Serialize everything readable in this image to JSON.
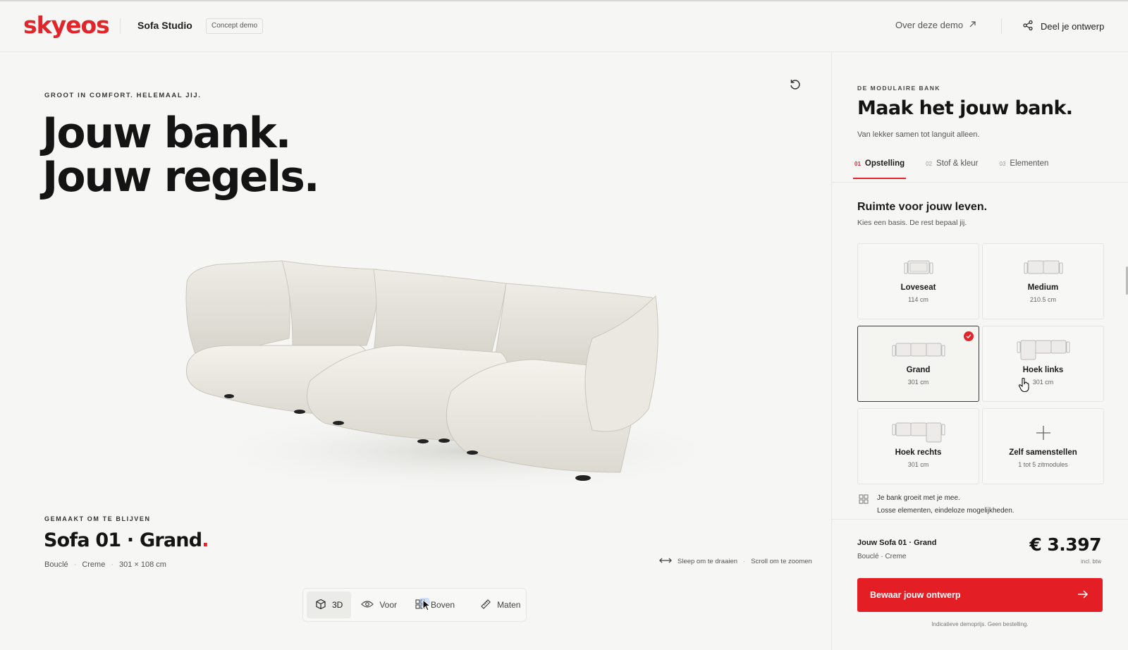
{
  "header": {
    "logo": "skyeos",
    "app_name": "Sofa Studio",
    "badge": "Concept demo",
    "about_link": "Over deze demo",
    "share_label": "Deel je ontwerp"
  },
  "stage": {
    "kicker": "GROOT IN COMFORT. HELEMAAL JIJ.",
    "headline_line1": "Jouw bank.",
    "headline_line2": "Jouw regels.",
    "made_kicker": "GEMAAKT OM TE BLIJVEN",
    "product_title": "Sofa 01 · Grand",
    "product_title_dot": ".",
    "meta": [
      "Bouclé",
      "Creme",
      "301 × 108 cm"
    ],
    "meta_sep": "·",
    "hint_drag": "Sleep om te draaien",
    "hint_sep": "·",
    "hint_scroll": "Scroll om te zoomen"
  },
  "view_toolbar": {
    "buttons": [
      {
        "label": "3D",
        "icon": "cube-icon",
        "active": true
      },
      {
        "label": "Voor",
        "icon": "eye-icon",
        "active": false
      },
      {
        "label": "Boven",
        "icon": "grid-icon",
        "active": false
      },
      {
        "label": "Maten",
        "icon": "ruler-icon",
        "active": false
      }
    ]
  },
  "panel": {
    "kicker": "DE MODULAIRE BANK",
    "title": "Maak het jouw bank.",
    "subtitle": "Van lekker samen tot languit alleen.",
    "tabs": [
      {
        "num": "01",
        "label": "Opstelling",
        "active": true
      },
      {
        "num": "02",
        "label": "Stof & kleur",
        "active": false
      },
      {
        "num": "03",
        "label": "Elementen",
        "active": false
      }
    ],
    "section_title": "Ruimte voor jouw leven.",
    "section_sub": "Kies een basis. De rest bepaal jij.",
    "options": [
      {
        "label": "Loveseat",
        "size": "114 cm",
        "selected": false,
        "icon": "loveseat-icon"
      },
      {
        "label": "Medium",
        "size": "210.5 cm",
        "selected": false,
        "icon": "medium-sofa-icon"
      },
      {
        "label": "Grand",
        "size": "301 cm",
        "selected": true,
        "icon": "grand-sofa-icon"
      },
      {
        "label": "Hoek links",
        "size": "301 cm",
        "selected": false,
        "icon": "corner-left-icon"
      },
      {
        "label": "Hoek rechts",
        "size": "301 cm",
        "selected": false,
        "icon": "corner-right-icon"
      },
      {
        "label": "Zelf samenstellen",
        "size": "1 tot 5 zitmodules",
        "selected": false,
        "icon": "plus-icon"
      }
    ],
    "info_line1": "Je bank groeit met je mee.",
    "info_line2": "Losse elementen, eindeloze mogelijkheden.",
    "summary_title": "Jouw Sofa 01 · Grand",
    "summary_sub": "Bouclé · Creme",
    "price": "€ 3.397",
    "price_note": "incl. btw",
    "cta_label": "Bewaar jouw ontwerp",
    "disclaimer": "Indicatieve demoprijs. Geen bestelling."
  },
  "colors": {
    "brand_red": "#e0262b",
    "cta_red": "#e31e25",
    "background": "#f6f6f4",
    "text": "#141414"
  }
}
